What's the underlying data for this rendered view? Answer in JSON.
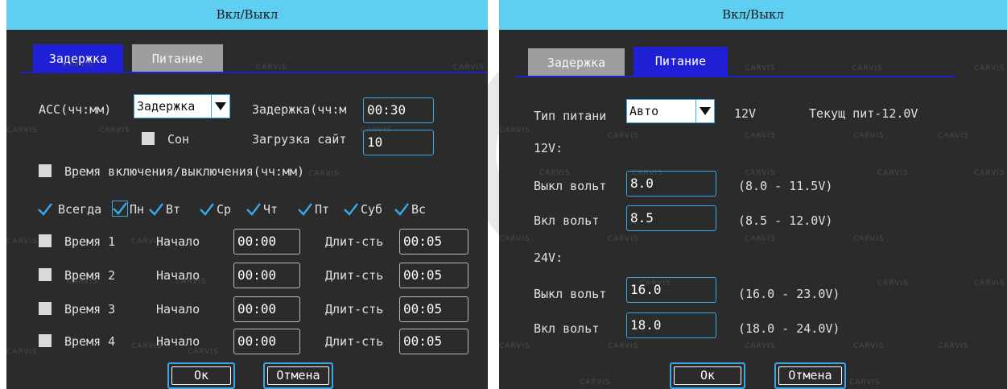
{
  "colors": {
    "accent": "#39a8e8",
    "tab_active": "#1f1fd6",
    "title_bar": "#5ecff0",
    "panel_bg": "#2b2b2b"
  },
  "watermark": "CARVIS",
  "left": {
    "title": "Вкл/Выкл",
    "tabs": [
      {
        "label": "Задержка",
        "active": true
      },
      {
        "label": "Питание",
        "active": false
      }
    ],
    "acc_label": "ACC(чч:мм)",
    "acc_select": "Задержка",
    "delay_label": "Задержка(чч:м",
    "delay_value": "00:30",
    "sleep_label": "Сон",
    "upload_label": "Загрузка сайт",
    "upload_value": "10",
    "onoff_time_label": "Время включения/выключения(чч:мм)",
    "days": [
      "Всегда",
      "Пн",
      "Вт",
      "Ср",
      "Чт",
      "Пт",
      "Суб",
      "Вс"
    ],
    "time_rows": [
      {
        "label": "Время 1",
        "start_label": "Начало",
        "start": "00:00",
        "dur_label": "Длит-сть",
        "dur": "00:05"
      },
      {
        "label": "Время 2",
        "start_label": "Начало",
        "start": "00:00",
        "dur_label": "Длит-сть",
        "dur": "00:05"
      },
      {
        "label": "Время 3",
        "start_label": "Начало",
        "start": "00:00",
        "dur_label": "Длит-сть",
        "dur": "00:05"
      },
      {
        "label": "Время 4",
        "start_label": "Начало",
        "start": "00:00",
        "dur_label": "Длит-сть",
        "dur": "00:05"
      }
    ],
    "ok": "Ок",
    "cancel": "Отмена"
  },
  "right": {
    "title": "Вкл/Выкл",
    "tabs": [
      {
        "label": "Задержка",
        "active": false
      },
      {
        "label": "Питание",
        "active": true
      }
    ],
    "power_type_label": "Тип питани",
    "power_type_select": "Авто",
    "power_voltage": "12V",
    "current_power": "Текущ пит-12.0V",
    "section_12v": "12V:",
    "section_24v": "24V:",
    "rows": [
      {
        "label": "Выкл вольт",
        "value": "8.0",
        "range": "(8.0 - 11.5V)"
      },
      {
        "label": "Вкл вольт",
        "value": "8.5",
        "range": "(8.5 - 12.0V)"
      },
      {
        "label": "Выкл вольт",
        "value": "16.0",
        "range": "(16.0 - 23.0V)"
      },
      {
        "label": "Вкл вольт",
        "value": "18.0",
        "range": "(18.0 - 24.0V)"
      }
    ],
    "ok": "Ок",
    "cancel": "Отмена"
  }
}
